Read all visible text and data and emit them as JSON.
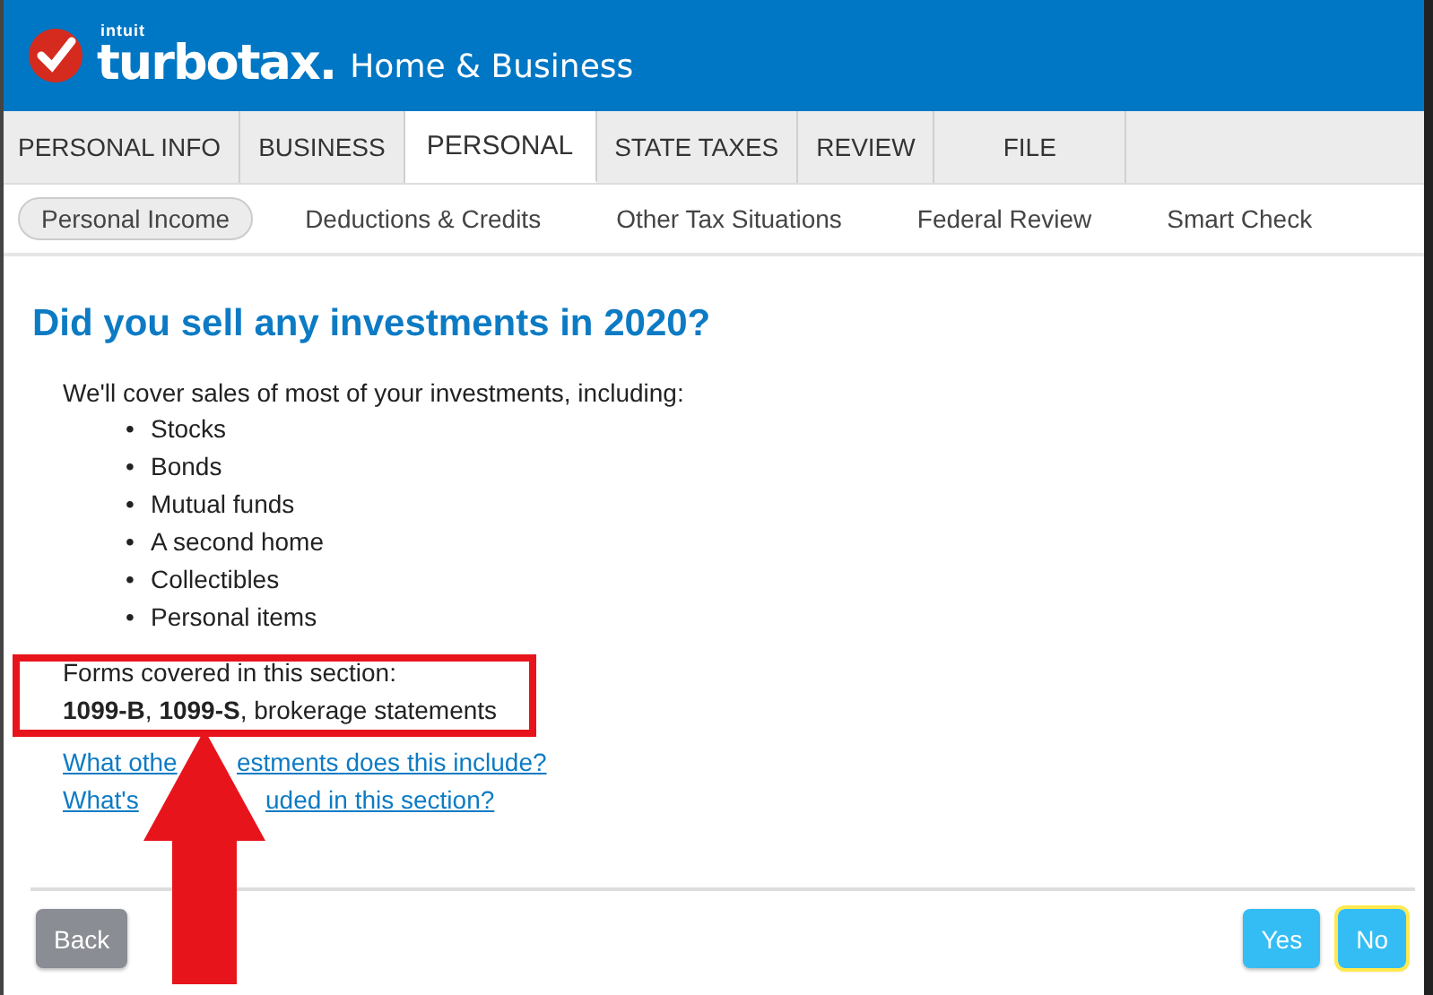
{
  "header": {
    "brand_top": "intuit",
    "brand": "turbotax",
    "brand_suffix": ".",
    "product": "Home & Business"
  },
  "tabs": [
    {
      "label": "PERSONAL INFO",
      "selected": false
    },
    {
      "label": "BUSINESS",
      "selected": false
    },
    {
      "label": "PERSONAL",
      "selected": true
    },
    {
      "label": "STATE TAXES",
      "selected": false
    },
    {
      "label": "REVIEW",
      "selected": false
    },
    {
      "label": "FILE",
      "selected": false
    }
  ],
  "subtabs": [
    {
      "label": "Personal Income",
      "selected": true
    },
    {
      "label": "Deductions & Credits",
      "selected": false
    },
    {
      "label": "Other Tax Situations",
      "selected": false
    },
    {
      "label": "Federal Review",
      "selected": false
    },
    {
      "label": "Smart Check",
      "selected": false
    }
  ],
  "title": "Did you sell any investments in 2020?",
  "intro": "We'll cover sales of most of your investments, including:",
  "bullet_marker": "•",
  "bullets": [
    "Stocks",
    "Bonds",
    "Mutual funds",
    "A second home",
    "Collectibles",
    "Personal items"
  ],
  "forms_label": "Forms covered in this section:",
  "forms_text": "**1099-B**, **1099-S**, brokerage statements",
  "links": [
    {
      "parts": [
        "What othe",
        "estments does this include?"
      ]
    },
    {
      "parts": [
        "What's",
        "uded in this section?"
      ]
    }
  ],
  "buttons": [
    {
      "kind": "back",
      "label": "Back",
      "focused": false
    },
    {
      "kind": "primary",
      "label": "Yes",
      "focused": false
    },
    {
      "kind": "primary",
      "label": "No",
      "focused": true
    }
  ]
}
